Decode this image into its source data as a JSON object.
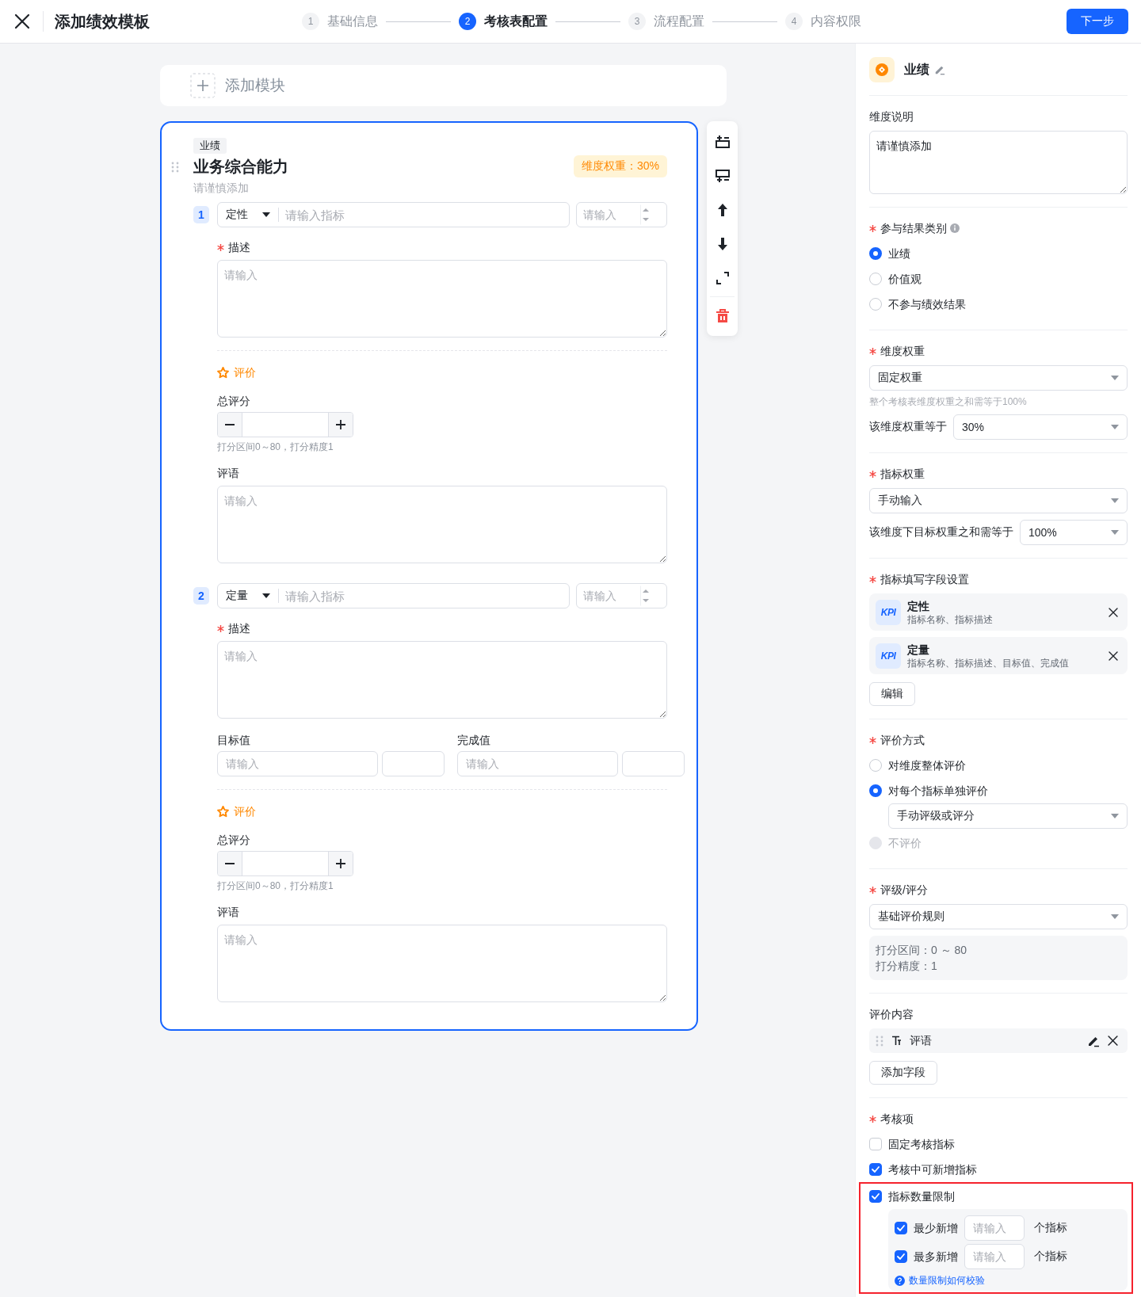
{
  "header": {
    "title": "添加绩效模板",
    "steps": [
      {
        "number": "1",
        "label": "基础信息",
        "selected": false
      },
      {
        "number": "2",
        "label": "考核表配置",
        "selected": true
      },
      {
        "number": "3",
        "label": "流程配置",
        "selected": false
      },
      {
        "number": "4",
        "label": "内容权限",
        "selected": false
      }
    ],
    "next_button": "下一步"
  },
  "add_module": {
    "label": "添加模块"
  },
  "dimension": {
    "tag": "业绩",
    "title": "业务综合能力",
    "weight_badge": "维度权重：30%",
    "note": "请谨慎添加",
    "indicators": [
      {
        "index": "1",
        "kind": "qualitative",
        "type": "定性",
        "name_placeholder": "请输入指标",
        "weight_placeholder": "请输入",
        "description_label": "描述",
        "description_required": true,
        "description_placeholder": "请输入",
        "evaluation": {
          "title": "评价",
          "score_label": "总评分",
          "score_hint": "打分区间0～80，打分精度1",
          "comment_label": "评语",
          "comment_placeholder": "请输入"
        }
      },
      {
        "index": "2",
        "kind": "quantitative",
        "type": "定量",
        "name_placeholder": "请输入指标",
        "weight_placeholder": "请输入",
        "description_label": "描述",
        "description_required": true,
        "description_placeholder": "请输入",
        "target_label": "目标值",
        "target_placeholder": "请输入",
        "actual_label": "完成值",
        "actual_placeholder": "请输入",
        "evaluation": {
          "title": "评价",
          "score_label": "总评分",
          "score_hint": "打分区间0～80，打分精度1",
          "comment_label": "评语",
          "comment_placeholder": "请输入"
        }
      }
    ]
  },
  "panel": {
    "title": "业绩",
    "description": {
      "label": "维度说明",
      "required": false,
      "value": "请谨慎添加"
    },
    "result_category": {
      "label": "参与结果类别",
      "required": true,
      "options": [
        {
          "label": "业绩",
          "selected": true
        },
        {
          "label": "价值观",
          "selected": false
        },
        {
          "label": "不参与绩效结果",
          "selected": false
        }
      ]
    },
    "dimension_weight": {
      "label": "维度权重",
      "required": true,
      "mode": "固定权重",
      "hint": "整个考核表维度权重之和需等于100%",
      "value_label": "该维度权重等于",
      "value": "30%"
    },
    "indicator_weight": {
      "label": "指标权重",
      "required": true,
      "mode": "手动输入",
      "value_label": "该维度下目标权重之和需等于",
      "value": "100%"
    },
    "field_settings": {
      "label": "指标填写字段设置",
      "required": true,
      "items": [
        {
          "badge": "KPI",
          "name": "定性",
          "fields": "指标名称、指标描述"
        },
        {
          "badge": "KPI",
          "name": "定量",
          "fields": "指标名称、指标描述、目标值、完成值"
        }
      ],
      "button": "编辑"
    },
    "evaluation_method": {
      "label": "评价方式",
      "required": true,
      "options": [
        {
          "label": "对维度整体评价",
          "selected": false,
          "disabled": false
        },
        {
          "label": "对每个指标单独评价",
          "selected": true,
          "disabled": false,
          "mode": "手动评级或评分"
        },
        {
          "label": "不评价",
          "selected": false,
          "disabled": true
        }
      ]
    },
    "rating": {
      "label": "评级/评分",
      "required": true,
      "rule": "基础评价规则",
      "details": [
        "打分区间：0 ～ 80",
        "打分精度：1"
      ]
    },
    "content": {
      "label": "评价内容",
      "required": false,
      "items": [
        {
          "label": "评语"
        }
      ],
      "button": "添加字段"
    },
    "review_items": {
      "label": "考核项",
      "required": true,
      "options": [
        {
          "label": "固定考核指标",
          "checked": false,
          "highlighted": false
        },
        {
          "label": "考核中可新增指标",
          "checked": true,
          "highlighted": false
        },
        {
          "label": "指标数量限制",
          "checked": true,
          "highlighted": true,
          "limits": [
            {
              "label": "最少新增",
              "checked": true,
              "placeholder": "请输入",
              "unit": "个指标"
            },
            {
              "label": "最多新增",
              "checked": true,
              "placeholder": "请输入",
              "unit": "个指标"
            }
          ],
          "help_link": "数量限制如何校验"
        }
      ]
    }
  }
}
